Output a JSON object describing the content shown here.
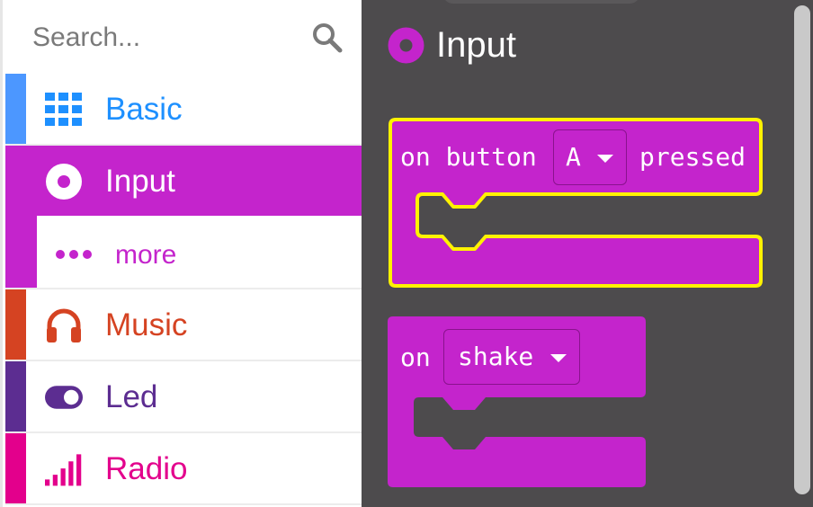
{
  "search": {
    "placeholder": "Search..."
  },
  "categories": [
    {
      "label": "Basic",
      "color": "#1e90ff",
      "icon": "grid-icon"
    },
    {
      "label": "Input",
      "color": "#c424cc",
      "icon": "radio-button-icon",
      "selected": true
    },
    {
      "label": "more",
      "color": "#c424cc",
      "icon": "more-dots-icon"
    },
    {
      "label": "Music",
      "color": "#d54322",
      "icon": "headphones-icon"
    },
    {
      "label": "Led",
      "color": "#5c2d91",
      "icon": "toggle-icon"
    },
    {
      "label": "Radio",
      "color": "#e3008c",
      "icon": "signal-bars-icon"
    }
  ],
  "flyout": {
    "title": "Input",
    "blocks": [
      {
        "prefix": "on button",
        "dropdown": "A",
        "suffix": "pressed",
        "highlighted": true
      },
      {
        "prefix": "on",
        "dropdown": "shake"
      }
    ]
  },
  "colors": {
    "input": "#c424cc",
    "flyout_bg": "#4d4b4d",
    "highlight": "#fff200"
  }
}
